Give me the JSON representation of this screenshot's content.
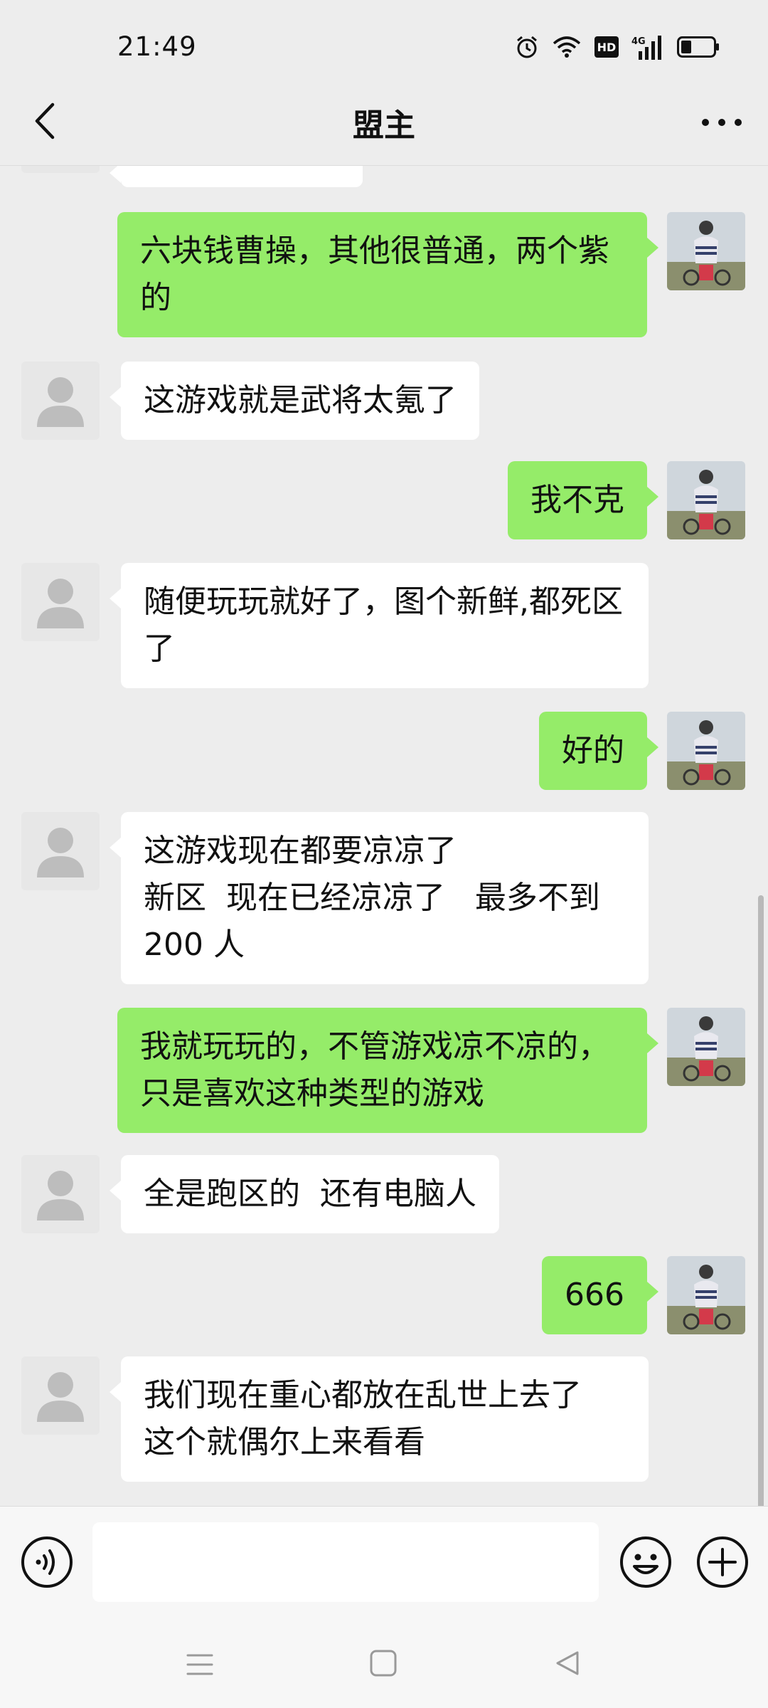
{
  "status_bar": {
    "time": "21:49",
    "icons": [
      "alarm-icon",
      "wifi-icon",
      "hd-icon",
      "signal-4g-icon",
      "battery-icon"
    ],
    "hd_label": "HD",
    "network_label": "4G"
  },
  "header": {
    "title": "盟主",
    "back_icon": "chevron-left-icon",
    "more_icon": "more-icon"
  },
  "messages": [
    {
      "side": "out",
      "text": "六块钱曹操，其他很普通，两个紫的"
    },
    {
      "side": "in",
      "text": "这游戏就是武将太氪了"
    },
    {
      "side": "out",
      "text": "我不克"
    },
    {
      "side": "in",
      "text": "随便玩玩就好了，图个新鲜,都死区了"
    },
    {
      "side": "out",
      "text": "好的"
    },
    {
      "side": "in",
      "text": "这游戏现在都要凉凉了\n新区  现在已经凉凉了   最多不到200 人"
    },
    {
      "side": "out",
      "text": "我就玩玩的，不管游戏凉不凉的，只是喜欢这种类型的游戏"
    },
    {
      "side": "in",
      "text": "全是跑区的  还有电脑人"
    },
    {
      "side": "out",
      "text": "666"
    },
    {
      "side": "in",
      "text": "我们现在重心都放在乱世上去了\n这个就偶尔上来看看"
    }
  ],
  "input_bar": {
    "placeholder": "",
    "voice_icon": "voice-icon",
    "emoji_icon": "emoji-icon",
    "plus_icon": "plus-icon"
  },
  "nav_bar": {
    "icons": [
      "menu-icon",
      "home-icon",
      "back-icon"
    ]
  },
  "colors": {
    "background": "#ededed",
    "out_bubble": "#95ec69",
    "in_bubble": "#ffffff"
  }
}
